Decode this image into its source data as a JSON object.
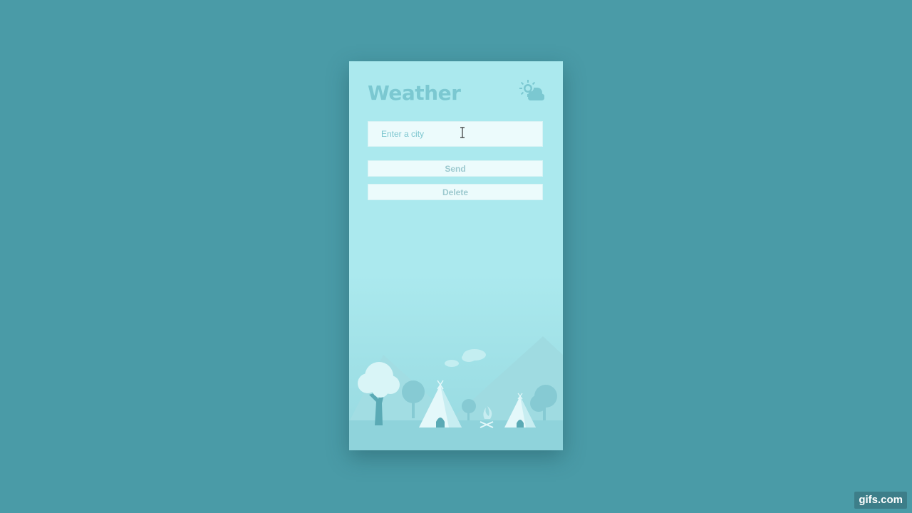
{
  "app": {
    "title": "Weather"
  },
  "search": {
    "placeholder": "Enter a city",
    "value": ""
  },
  "buttons": {
    "send_label": "Send",
    "delete_label": "Delete"
  },
  "icons": {
    "header": "partly-cloudy-icon",
    "cursor": "text-cursor-icon"
  },
  "watermark": {
    "text": "gifs.com"
  },
  "colors": {
    "background": "#4a9ba7",
    "card": "#abe9ee",
    "title": "#7bc8d1",
    "field": "#ecfbfc",
    "accent": "#5ab3bf"
  }
}
